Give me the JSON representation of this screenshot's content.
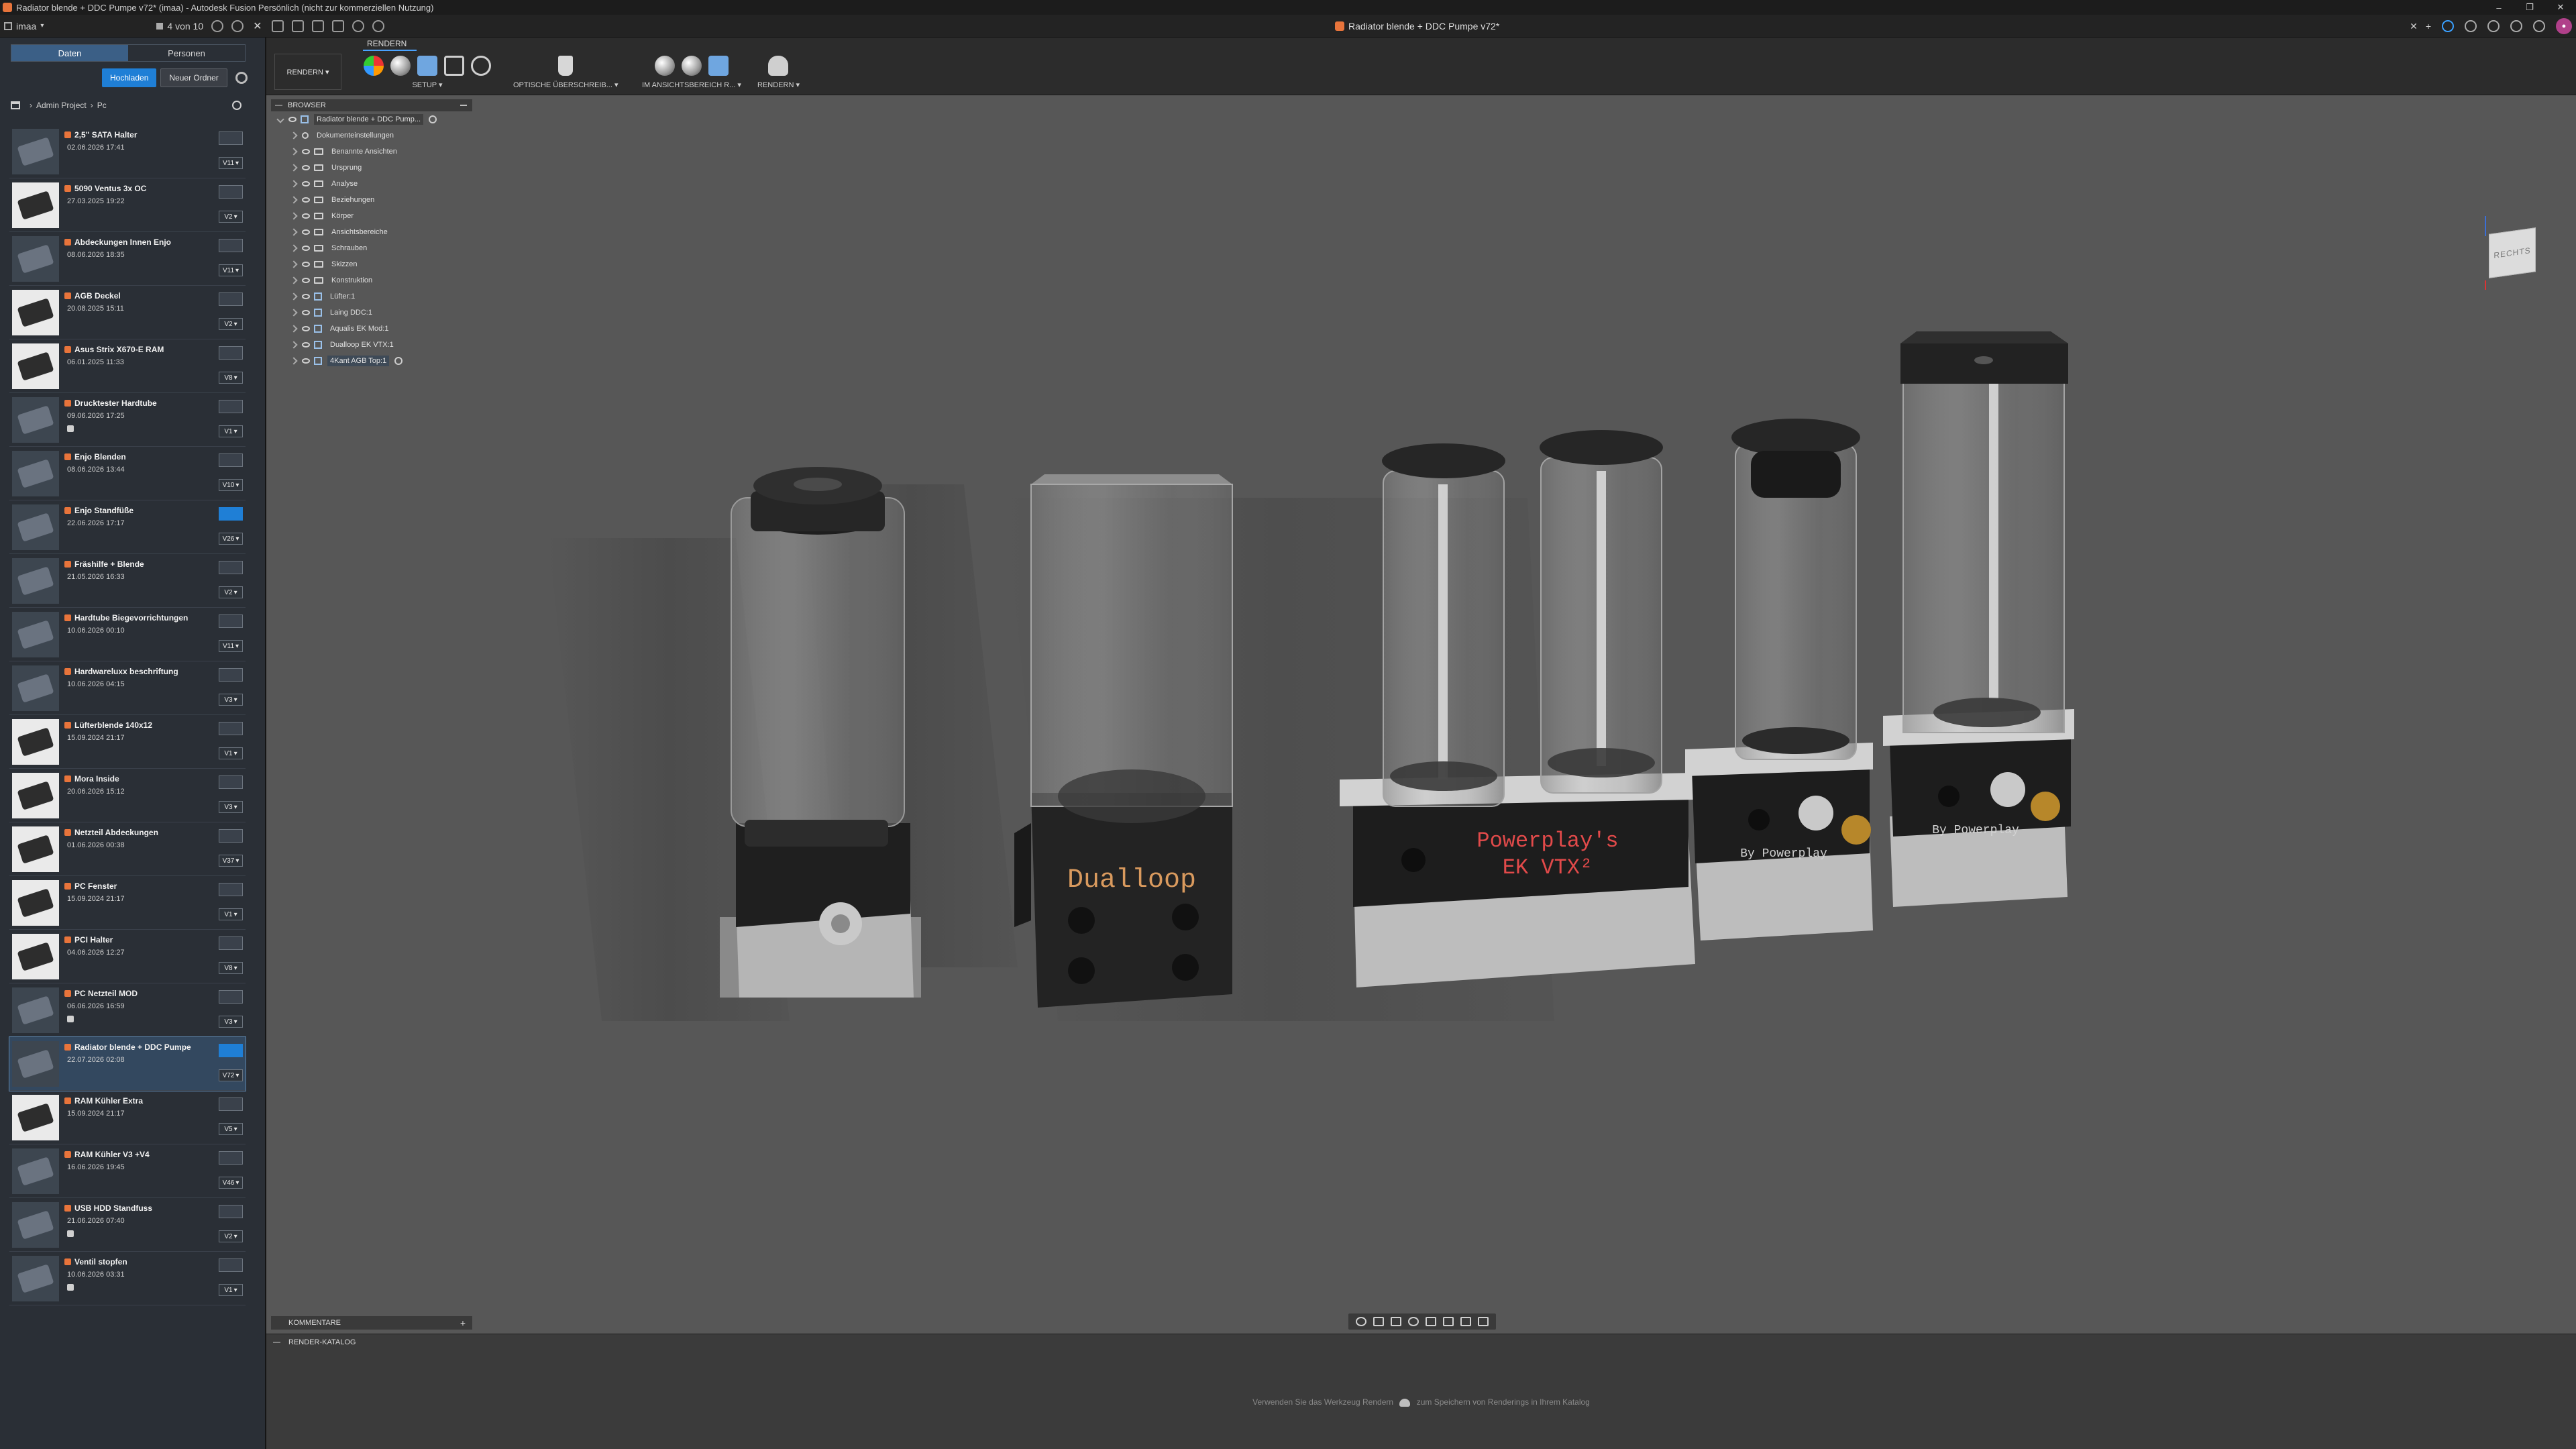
{
  "window": {
    "title": "Radiator blende + DDC Pumpe v72* (imaa) - Autodesk Fusion Persönlich (nicht zur kommerziellen Nutzung)",
    "doc_tab": "Radiator blende + DDC Pumpe v72*",
    "controls": [
      "–",
      "❐",
      "✕"
    ]
  },
  "app_toolbar": {
    "user": "imaa",
    "counter": "4 von 10"
  },
  "data_panel": {
    "tabs": [
      "Daten",
      "Personen"
    ],
    "upload_label": "Hochladen",
    "new_folder_label": "Neuer Ordner",
    "breadcrumb": [
      "Admin Project",
      "Pc"
    ],
    "files": [
      {
        "name": "2,5\" SATA Halter",
        "date": "02.06.2026 17:41",
        "version": "V11",
        "thumb": "dark",
        "link": false
      },
      {
        "name": "5090 Ventus 3x OC",
        "date": "27.03.2025 19:22",
        "version": "V2",
        "thumb": "light",
        "link": false
      },
      {
        "name": "Abdeckungen Innen Enjo",
        "date": "08.06.2026 18:35",
        "version": "V11",
        "thumb": "dark",
        "link": false
      },
      {
        "name": "AGB Deckel",
        "date": "20.08.2025 15:11",
        "version": "V2",
        "thumb": "light",
        "link": false
      },
      {
        "name": "Asus Strix X670-E RAM",
        "date": "06.01.2025 11:33",
        "version": "V8",
        "thumb": "light",
        "link": false
      },
      {
        "name": "Drucktester Hardtube",
        "date": "09.06.2026 17:25",
        "version": "V1",
        "thumb": "dark",
        "link": true
      },
      {
        "name": "Enjo Blenden",
        "date": "08.06.2026 13:44",
        "version": "V10",
        "thumb": "dark",
        "link": false
      },
      {
        "name": "Enjo Standfüße",
        "date": "22.06.2026 17:17",
        "version": "V26",
        "thumb": "dark",
        "link": false,
        "active": true
      },
      {
        "name": "Fräshilfe + Blende",
        "date": "21.05.2026 16:33",
        "version": "V2",
        "thumb": "dark",
        "link": false
      },
      {
        "name": "Hardtube Biegevorrichtungen",
        "date": "10.06.2026 00:10",
        "version": "V11",
        "thumb": "dark",
        "link": false
      },
      {
        "name": "Hardwareluxx beschriftung",
        "date": "10.06.2026 04:15",
        "version": "V3",
        "thumb": "dark",
        "link": false
      },
      {
        "name": "Lüfterblende 140x12",
        "date": "15.09.2024 21:17",
        "version": "V1",
        "thumb": "light",
        "link": false
      },
      {
        "name": "Mora Inside",
        "date": "20.06.2026 15:12",
        "version": "V3",
        "thumb": "light",
        "link": false
      },
      {
        "name": "Netzteil Abdeckungen",
        "date": "01.06.2026 00:38",
        "version": "V37",
        "thumb": "light",
        "link": false
      },
      {
        "name": "PC Fenster",
        "date": "15.09.2024 21:17",
        "version": "V1",
        "thumb": "light",
        "link": false
      },
      {
        "name": "PCI Halter",
        "date": "04.06.2026 12:27",
        "version": "V8",
        "thumb": "light",
        "link": false
      },
      {
        "name": "PC Netzteil MOD",
        "date": "06.06.2026 16:59",
        "version": "V3",
        "thumb": "dark",
        "link": true
      },
      {
        "name": "Radiator blende + DDC Pumpe",
        "date": "22.07.2026 02:08",
        "version": "V72",
        "thumb": "dark",
        "link": false,
        "selected": true,
        "active": true
      },
      {
        "name": "RAM Kühler Extra",
        "date": "15.09.2024 21:17",
        "version": "V5",
        "thumb": "light",
        "link": false
      },
      {
        "name": "RAM Kühler V3 +V4",
        "date": "16.06.2026 19:45",
        "version": "V46",
        "thumb": "dark",
        "link": false
      },
      {
        "name": "USB HDD Standfuss",
        "date": "21.06.2026 07:40",
        "version": "V2",
        "thumb": "dark",
        "link": true
      },
      {
        "name": "Ventil stopfen",
        "date": "10.06.2026 03:31",
        "version": "V1",
        "thumb": "dark",
        "link": true
      }
    ]
  },
  "ribbon": {
    "tab": "RENDERN",
    "workspace": "RENDERN ▾",
    "groups": [
      "SETUP ▾",
      "OPTISCHE ÜBERSCHREIB... ▾",
      "IM ANSICHTSBEREICH R... ▾",
      "RENDERN ▾"
    ]
  },
  "browser": {
    "header": "BROWSER",
    "root": "Radiator blende + DDC Pump...",
    "items": [
      {
        "label": "Dokumenteinstellungen",
        "kind": "gear"
      },
      {
        "label": "Benannte Ansichten",
        "kind": "folder"
      },
      {
        "label": "Ursprung",
        "kind": "folder"
      },
      {
        "label": "Analyse",
        "kind": "folder"
      },
      {
        "label": "Beziehungen",
        "kind": "folder"
      },
      {
        "label": "Körper",
        "kind": "folder"
      },
      {
        "label": "Ansichtsbereiche",
        "kind": "folder"
      },
      {
        "label": "Schrauben",
        "kind": "folder"
      },
      {
        "label": "Skizzen",
        "kind": "folder"
      },
      {
        "label": "Konstruktion",
        "kind": "folder"
      },
      {
        "label": "Lüfter:1",
        "kind": "comp"
      },
      {
        "label": "Laing DDC:1",
        "kind": "comp"
      },
      {
        "label": "Aqualis EK Mod:1",
        "kind": "comp"
      },
      {
        "label": "Dualloop EK VTX:1",
        "kind": "comp"
      },
      {
        "label": "4Kant AGB Top:1",
        "kind": "comp",
        "active": true
      }
    ]
  },
  "viewcube_label": "RECHTS",
  "comments_label": "KOMMENTARE",
  "render_catalog": {
    "header": "RENDER-KATALOG",
    "hint_before": "Verwenden Sie das Werkzeug Rendern",
    "hint_after": "zum Speichern von Renderings in Ihrem Katalog"
  },
  "model_labels": {
    "dualloop": "Dualloop",
    "powerplay_line1": "Powerplay's",
    "powerplay_line2": "EK VTX²",
    "by_powerplay": "By Powerplay"
  }
}
